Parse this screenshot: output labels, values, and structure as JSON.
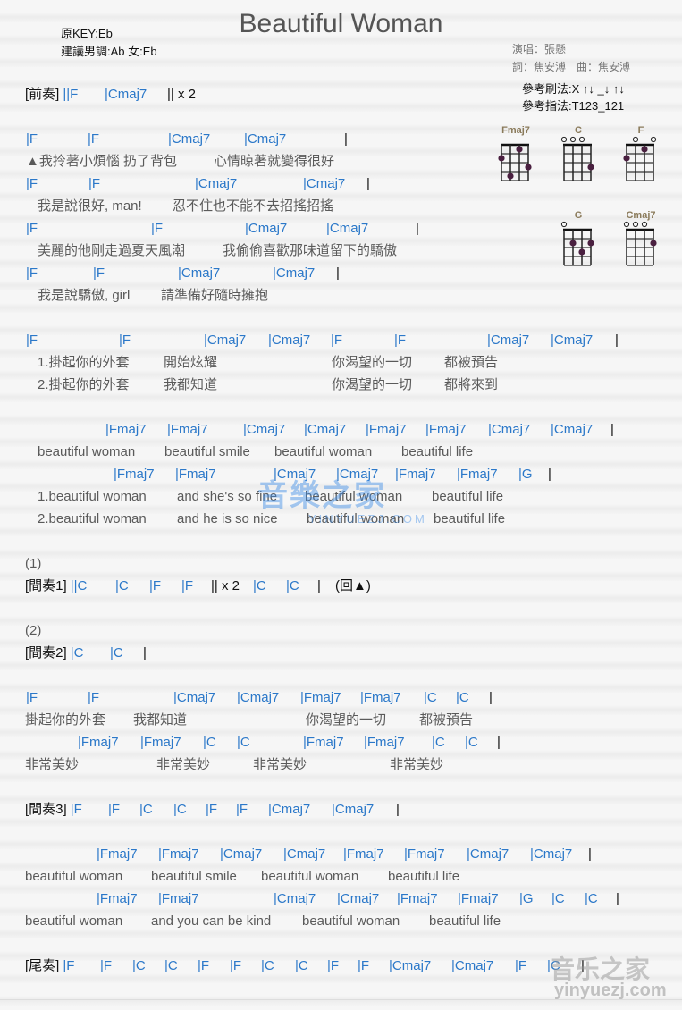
{
  "header": {
    "title": "Beautiful Woman",
    "original_key": "原KEY:Eb",
    "suggested_key": "建議男調:Ab 女:Eb",
    "singer": "演唱：張懸",
    "writers": "詞：焦安溥　曲：焦安溥",
    "strum_pattern": "參考刷法:X ↑↓ _↓ ↑↓",
    "finger_pattern": "參考指法:T123_121"
  },
  "chord_charts": [
    {
      "name": "Fmaj7",
      "frets": [
        2,
        4,
        1,
        3
      ]
    },
    {
      "name": "C",
      "frets": [
        0,
        0,
        0,
        3
      ]
    },
    {
      "name": "F",
      "frets": [
        2,
        0,
        1,
        0
      ]
    },
    {
      "name": "G",
      "frets": [
        0,
        2,
        3,
        2
      ]
    },
    {
      "name": "Cmaj7",
      "frets": [
        0,
        0,
        0,
        2
      ]
    }
  ],
  "lines": [
    {
      "kind": "chords",
      "label": "[前奏]",
      "items": [
        "||F",
        "|Cmaj7",
        "|| x 2"
      ]
    },
    {
      "kind": "chords",
      "items": [
        "|F",
        "|F",
        "|Cmaj7",
        "|Cmaj7",
        "|"
      ]
    },
    {
      "kind": "lyric",
      "items": [
        "▲我拎著小煩惱 扔了背包",
        "心情晾著就變得很好"
      ]
    },
    {
      "kind": "chords",
      "items": [
        "|F",
        "|F",
        "|Cmaj7",
        "|Cmaj7",
        "|"
      ]
    },
    {
      "kind": "lyric",
      "items": [
        "我是說很好, man!",
        "忍不住也不能不去招搖招搖"
      ]
    },
    {
      "kind": "chords",
      "items": [
        "|F",
        "|F",
        "|Cmaj7",
        "|Cmaj7",
        "|"
      ]
    },
    {
      "kind": "lyric",
      "items": [
        "美麗的他剛走過夏天風潮",
        "我偷偷喜歡那味道留下的驕傲"
      ]
    },
    {
      "kind": "chords",
      "items": [
        "|F",
        "|F",
        "|Cmaj7",
        "|Cmaj7",
        "|"
      ]
    },
    {
      "kind": "lyric",
      "items": [
        "我是說驕傲, girl",
        "請準備好隨時擁抱"
      ]
    },
    {
      "kind": "chords",
      "items": [
        "|F",
        "|F",
        "|Cmaj7",
        "|Cmaj7",
        "|F",
        "|F",
        "|Cmaj7",
        "|Cmaj7",
        "|"
      ]
    },
    {
      "kind": "lyric",
      "items": [
        "1.掛起你的外套",
        "開始炫耀",
        "你渴望的一切",
        "都被預告"
      ]
    },
    {
      "kind": "lyric",
      "items": [
        "2.掛起你的外套",
        "我都知道",
        "你渴望的一切",
        "都將來到"
      ]
    },
    {
      "kind": "chords",
      "items": [
        "|Fmaj7",
        "|Fmaj7",
        "|Cmaj7",
        "|Cmaj7",
        "|Fmaj7",
        "|Fmaj7",
        "|Cmaj7",
        "|Cmaj7",
        "|"
      ]
    },
    {
      "kind": "lyric",
      "items": [
        "beautiful woman",
        "beautiful smile",
        "beautiful woman",
        "beautiful life"
      ]
    },
    {
      "kind": "chords",
      "items": [
        "|Fmaj7",
        "|Fmaj7",
        "|Cmaj7",
        "|Cmaj7",
        "|Fmaj7",
        "|Fmaj7",
        "|G",
        "|"
      ]
    },
    {
      "kind": "lyric",
      "items": [
        "1.beautiful woman",
        "and she's so fine",
        "beautiful woman",
        "beautiful life"
      ]
    },
    {
      "kind": "lyric",
      "items": [
        "2.beautiful woman",
        "and he is so nice",
        "beautiful woman",
        "beautiful life"
      ]
    },
    {
      "kind": "lyric",
      "items": [
        "(1)"
      ]
    },
    {
      "kind": "chords",
      "label": "[間奏1]",
      "items": [
        "||C",
        "|C",
        "|F",
        "|F",
        "|| x 2",
        "|C",
        "|C",
        "|",
        "(回▲)"
      ]
    },
    {
      "kind": "lyric",
      "items": [
        "(2)"
      ]
    },
    {
      "kind": "chords",
      "label": "[間奏2]",
      "items": [
        "|C",
        "|C",
        "|"
      ]
    },
    {
      "kind": "chords",
      "items": [
        "|F",
        "|F",
        "|Cmaj7",
        "|Cmaj7",
        "|Fmaj7",
        "|Fmaj7",
        "|C",
        "|C",
        "|"
      ]
    },
    {
      "kind": "lyric",
      "items": [
        "掛起你的外套",
        "我都知道",
        "你渴望的一切",
        "都被預告"
      ]
    },
    {
      "kind": "chords",
      "items": [
        "|Fmaj7",
        "|Fmaj7",
        "|C",
        "|C",
        "|Fmaj7",
        "|Fmaj7",
        "|C",
        "|C",
        "|"
      ]
    },
    {
      "kind": "lyric",
      "items": [
        "非常美妙",
        "非常美妙",
        "非常美妙",
        "非常美妙"
      ]
    },
    {
      "kind": "chords",
      "label": "[間奏3]",
      "items": [
        "|F",
        "|F",
        "|C",
        "|C",
        "|F",
        "|F",
        "|Cmaj7",
        "|Cmaj7",
        "|"
      ]
    },
    {
      "kind": "chords",
      "items": [
        "|Fmaj7",
        "|Fmaj7",
        "|Cmaj7",
        "|Cmaj7",
        "|Fmaj7",
        "|Fmaj7",
        "|Cmaj7",
        "|Cmaj7",
        "|"
      ]
    },
    {
      "kind": "lyric",
      "items": [
        "beautiful woman",
        "beautiful smile",
        "beautiful woman",
        "beautiful life"
      ]
    },
    {
      "kind": "chords",
      "items": [
        "|Fmaj7",
        "|Fmaj7",
        "|Cmaj7",
        "|Cmaj7",
        "|Fmaj7",
        "|Fmaj7",
        "|G",
        "|C",
        "|C",
        "|"
      ]
    },
    {
      "kind": "lyric",
      "items": [
        "beautiful woman",
        "and you can be kind",
        "beautiful woman",
        "beautiful life"
      ]
    },
    {
      "kind": "chords",
      "label": "[尾奏]",
      "items": [
        "|F",
        "|F",
        "|C",
        "|C",
        "|F",
        "|F",
        "|C",
        "|C",
        "|F",
        "|F",
        "|Cmaj7",
        "|Cmaj7",
        "|F",
        "|C",
        "|"
      ]
    }
  ],
  "watermarks": {
    "center": "音樂之家",
    "center_sub": "YINYUEZJ.COM",
    "corner": "音乐之家",
    "corner_sub": "yinyuezj.com"
  },
  "colors": {
    "chord": "#2b78c9",
    "lyric": "#5a5a5a",
    "bar": "#2a2030",
    "dot": "#4a2040"
  }
}
